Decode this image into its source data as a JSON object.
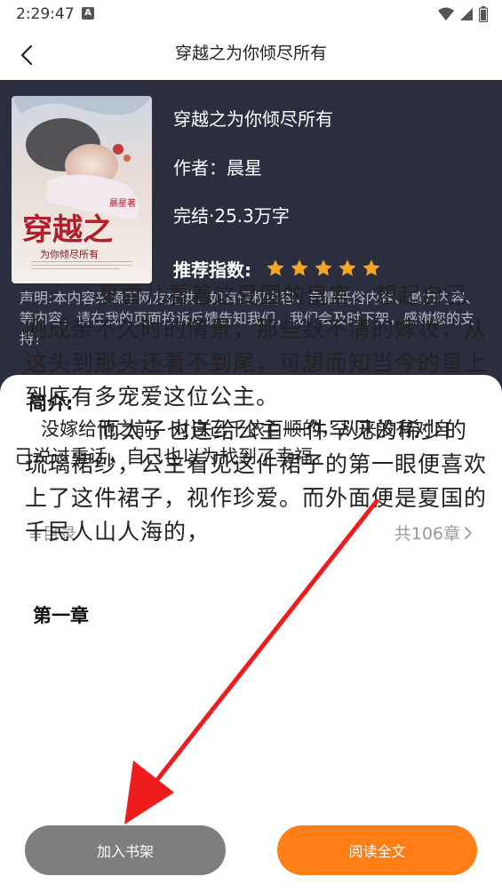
{
  "status_bar": {
    "time": "2:29:47"
  },
  "title_bar": {
    "title": "穿越之为你倾尽所有",
    "back_icon": "chevron-left-icon"
  },
  "book": {
    "name": "穿越之为你倾尽所有",
    "author": "作者：晨星",
    "status": "完结·25.3万字",
    "rating_label": "推荐指数:",
    "rating": 5,
    "rating_max": 5,
    "star_color": "#f5a623",
    "cover": {
      "author_mark": "晨星著",
      "title_big": "穿越之",
      "subtitle": "为你倾尽所有"
    }
  },
  "disclaimer": "声明:本内容来源于网友提供，如有侵权内容，色情低俗内容、暴力内容、等内容，请在我的页面投诉反馈告知我们，我们会及时下架，感谢您的支持！",
  "intro": {
    "title": "简介:",
    "text": "没嫁给他之前，对自己千依百顺的，从来没有对自己说过重话，自己也以为找到了幸福。"
  },
  "toc": {
    "label": "≡目录",
    "count": "共106章"
  },
  "chapter": {
    "title": "第一章",
    "paragraphs": [
      "夏雪儿看着这夏国的皇宫，想起自己刚成亲不久时的情景，那些数不清的嫁妆，从这头到那头还看不到尾，可想而知当今的皇上到底有多宠爱这位公主。",
      "而太子也送给公主一件罕见的稀少的琉璃裙纱，公主看见这件裙子的第一眼便喜欢上了这件裙子，视作珍爱。而外面便是夏国的千民人山人海的，"
    ]
  },
  "buttons": {
    "add_shelf": "加入书架",
    "read_all": "阅读全文"
  },
  "colors": {
    "header_bg": "#2b2e3f",
    "accent": "#ff7e16",
    "annotation": "#ee1c1c"
  }
}
